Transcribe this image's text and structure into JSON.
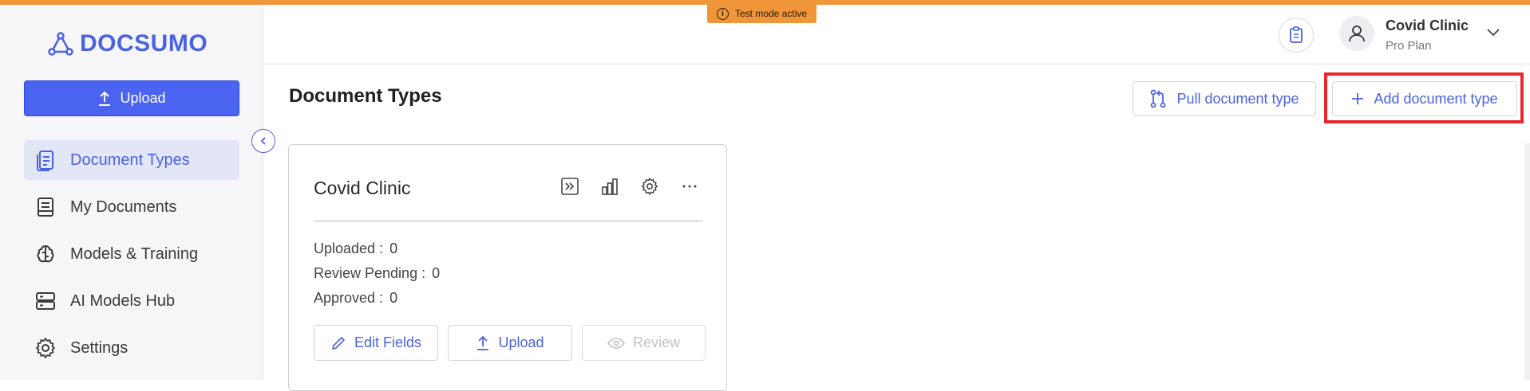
{
  "banner": {
    "test_mode": "Test mode active"
  },
  "sidebar": {
    "logo": "DOCSUMO",
    "upload_label": "Upload",
    "items": [
      {
        "label": "Document Types",
        "icon": "document-types-icon",
        "active": true
      },
      {
        "label": "My Documents",
        "icon": "my-documents-icon",
        "active": false
      },
      {
        "label": "Models & Training",
        "icon": "brain-icon",
        "active": false
      },
      {
        "label": "AI Models Hub",
        "icon": "server-icon",
        "active": false
      },
      {
        "label": "Settings",
        "icon": "gear-icon",
        "active": false
      }
    ]
  },
  "header": {
    "user_name": "Covid Clinic",
    "user_plan": "Pro Plan"
  },
  "main": {
    "title": "Document Types",
    "pull_label": "Pull document type",
    "add_label": "Add document type"
  },
  "card": {
    "title": "Covid Clinic",
    "stats": [
      {
        "label": "Uploaded :",
        "value": "0"
      },
      {
        "label": "Review Pending :",
        "value": "0"
      },
      {
        "label": "Approved :",
        "value": "0"
      }
    ],
    "edit_label": "Edit Fields",
    "upload_label": "Upload",
    "review_label": "Review"
  },
  "colors": {
    "accent": "#4a63e0",
    "test_banner": "#f0963a",
    "highlight": "#e8282d"
  }
}
